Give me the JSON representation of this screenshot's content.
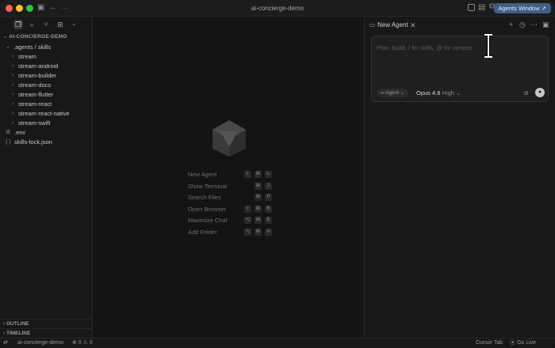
{
  "window": {
    "title": "ai-concierge-demo"
  },
  "titlebar": {
    "agents_window_label": "Agents Window ↗"
  },
  "sidebar": {
    "section_title": "AI-CONCIERGE-DEMO",
    "tree": [
      {
        "label": ".agents / skills",
        "chevron": "⌄",
        "depth": 0
      },
      {
        "label": "stream",
        "chevron": "›",
        "depth": 1
      },
      {
        "label": "stream-android",
        "chevron": "›",
        "depth": 1
      },
      {
        "label": "stream-builder",
        "chevron": "›",
        "depth": 1
      },
      {
        "label": "stream-docs",
        "chevron": "›",
        "depth": 1
      },
      {
        "label": "stream-flutter",
        "chevron": "›",
        "depth": 1
      },
      {
        "label": "stream-react",
        "chevron": "›",
        "depth": 1
      },
      {
        "label": "stream-react-native",
        "chevron": "›",
        "depth": 1
      },
      {
        "label": "stream-swift",
        "chevron": "›",
        "depth": 1
      },
      {
        "label": ".env",
        "chevron": "⚙",
        "depth": 0
      },
      {
        "label": "skills-lock.json",
        "chevron": "{ }",
        "depth": 0
      }
    ],
    "outline_label": "OUTLINE",
    "timeline_label": "TIMELINE"
  },
  "editor": {
    "shortcuts": [
      {
        "label": "New Agent",
        "keys": [
          "⇧",
          "⌘",
          "L"
        ]
      },
      {
        "label": "Show Terminal",
        "keys": [
          "",
          "⌘",
          "J"
        ]
      },
      {
        "label": "Search Files",
        "keys": [
          "",
          "⌘",
          "P"
        ]
      },
      {
        "label": "Open Browser",
        "keys": [
          "⇧",
          "⌘",
          "B"
        ]
      },
      {
        "label": "Maximize Chat",
        "keys": [
          "⌥",
          "⌘",
          "E"
        ]
      },
      {
        "label": "Add Folder",
        "keys": [
          "⌥",
          "⌘",
          "A"
        ]
      }
    ]
  },
  "agent_panel": {
    "tab_label": "New Agent",
    "composer_placeholder": "Plan, Build, / for skills, @ for context",
    "composer_value": "",
    "mode_label": "∞ Agent ⌄",
    "model_name": "Opus 4.8",
    "effort_label": "High ⌄"
  },
  "statusbar": {
    "branch": "ai-concierge-demo",
    "problems": "⊗ 0 ⚠ 0",
    "cursor_tab": "Cursor Tab",
    "go_live": "⦿ Go Live"
  }
}
